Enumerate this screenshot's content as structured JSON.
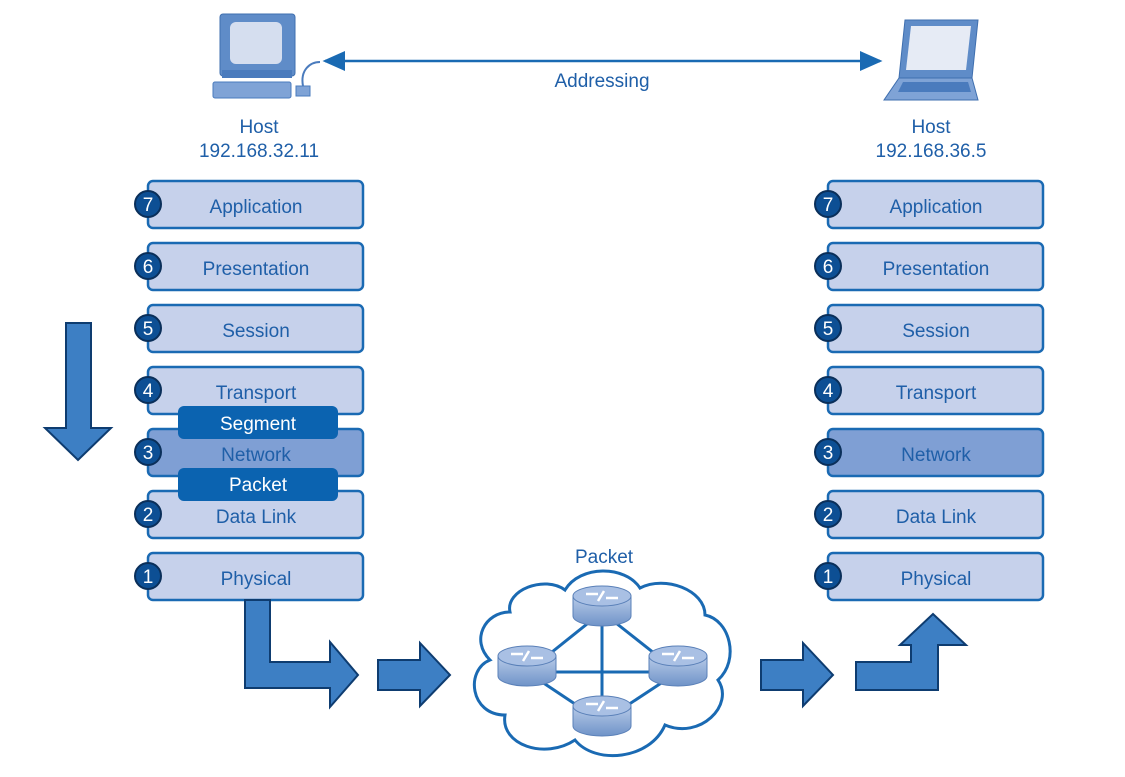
{
  "colors": {
    "layer_fill": "#c6d1eb",
    "layer_border": "#1a6ab3",
    "highlight_fill": "#7f9fd4",
    "text": "#1f5fa8",
    "pdu_fill": "#0b63b0",
    "arrow_fill": "#3d7fc4",
    "number_fill": "#0d4f94"
  },
  "addressing_label": "Addressing",
  "source_host": {
    "label": "Host",
    "ip": "192.168.32.11",
    "icon": "desktop-computer-icon"
  },
  "dest_host": {
    "label": "Host",
    "ip": "192.168.36.5",
    "icon": "laptop-icon"
  },
  "layers": [
    {
      "num": "7",
      "name": "Application"
    },
    {
      "num": "6",
      "name": "Presentation"
    },
    {
      "num": "5",
      "name": "Session"
    },
    {
      "num": "4",
      "name": "Transport"
    },
    {
      "num": "3",
      "name": "Network",
      "highlight": true
    },
    {
      "num": "2",
      "name": "Data Link"
    },
    {
      "num": "1",
      "name": "Physical"
    }
  ],
  "pdu_labels": {
    "segment": "Segment",
    "packet": "Packet"
  },
  "network_label": "Packet",
  "network_icon": "router-cloud-icon"
}
